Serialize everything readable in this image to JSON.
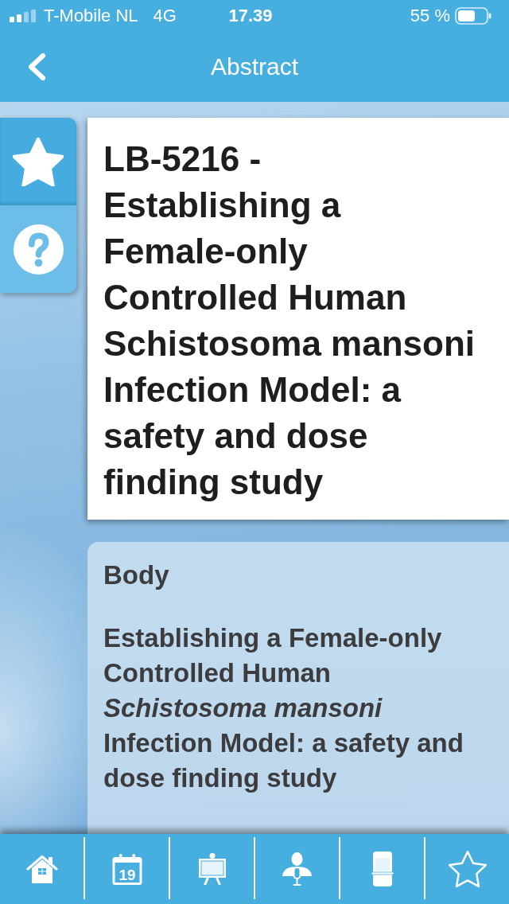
{
  "status_bar": {
    "carrier": "T-Mobile NL",
    "network": "4G",
    "time": "17.39",
    "battery": "55 %"
  },
  "nav_bar": {
    "title": "Abstract"
  },
  "side_actions": [
    {
      "kind": "star"
    },
    {
      "kind": "help"
    }
  ],
  "abstract": {
    "title": "LB-5216 - Establishing a Female-only Controlled Human Schistosoma mansoni Infection Model: a safety and dose finding study",
    "body_heading": "Body",
    "body_text": "Establishing a Female-only Controlled Human *Schistosoma mansoni* Infection Model: a safety and dose finding study"
  },
  "tab_bar": {
    "items": [
      {
        "kind": "house"
      },
      {
        "kind": "calendar",
        "label": "19"
      },
      {
        "kind": "easel"
      },
      {
        "kind": "presenter"
      },
      {
        "kind": "kiosk"
      },
      {
        "kind": "star"
      }
    ]
  }
}
